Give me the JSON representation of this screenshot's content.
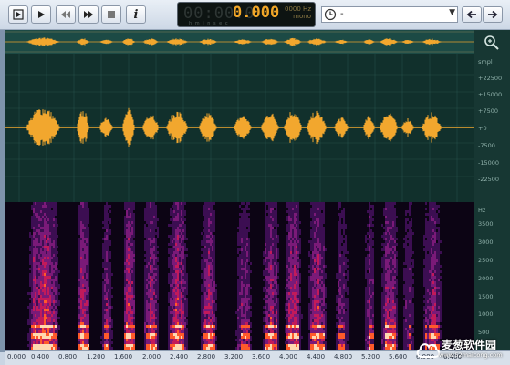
{
  "toolbar": {
    "buttons": [
      {
        "name": "stop-to-start-button",
        "icon": "skip-to-start-icon"
      },
      {
        "name": "play-button",
        "icon": "play-icon"
      },
      {
        "name": "rewind-button",
        "icon": "rewind-icon"
      },
      {
        "name": "fast-forward-button",
        "icon": "fast-forward-icon"
      },
      {
        "name": "stop-button",
        "icon": "stop-icon"
      },
      {
        "name": "info-button",
        "icon": "info-icon",
        "label": "i"
      }
    ]
  },
  "lcd": {
    "time_dim": "00:00:0",
    "time": "0.000",
    "frequency": "0000 Hz",
    "channel": "mono",
    "units": "h    m  i  n      s  e  c"
  },
  "history": {
    "value": "-",
    "icon": "clock-icon"
  },
  "nav": {
    "back_icon": "arrow-left-icon",
    "forward_icon": "arrow-right-icon"
  },
  "waveform_axis": {
    "unit": "smpl",
    "ticks": [
      "+22500",
      "+15000",
      "+7500",
      "+0",
      "-7500",
      "-15000",
      "-22500"
    ]
  },
  "spectrogram_axis": {
    "unit": "Hz",
    "ticks": [
      "3500",
      "3000",
      "2500",
      "2000",
      "1500",
      "1000",
      "500"
    ]
  },
  "timeline": {
    "ticks": [
      "0.000",
      "0.400",
      "0.800",
      "1.200",
      "1.600",
      "2.000",
      "2.400",
      "2.800",
      "3.200",
      "3.600",
      "4.000",
      "4.400",
      "4.800",
      "5.200",
      "5.600",
      "6.000",
      "6.400"
    ]
  },
  "watermark": {
    "title": "麦葱软件园",
    "url": "www.52maicong.com"
  },
  "colors": {
    "waveform": "#f2a72e",
    "waveform_bg": "#11302c",
    "spectro_bg": "#0c0414"
  }
}
